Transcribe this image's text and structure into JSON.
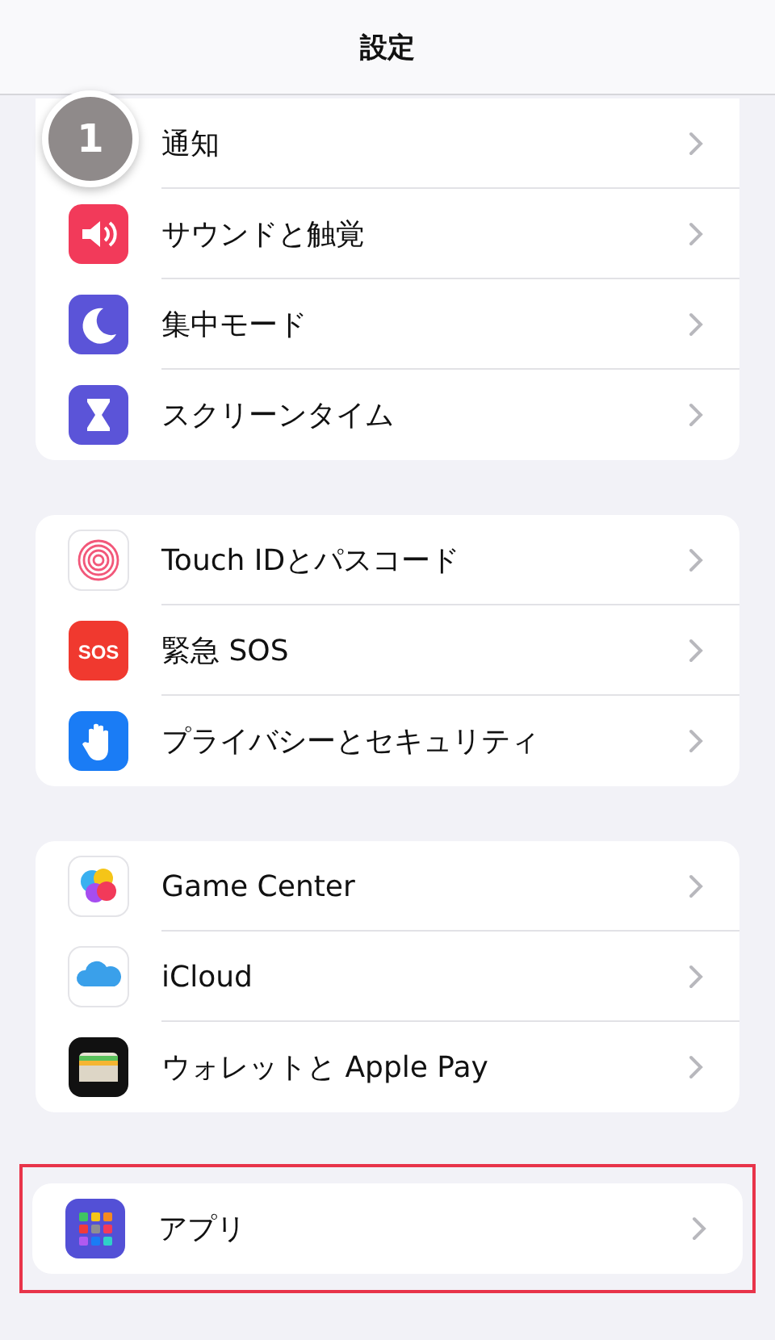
{
  "header": {
    "title": "設定"
  },
  "step_badge": {
    "label": "1"
  },
  "groups": [
    {
      "highlighted": false,
      "rows": [
        {
          "label": "通知"
        },
        {
          "kind": "sound",
          "label": "サウンドと触覚"
        },
        {
          "kind": "focus",
          "label": "集中モード"
        },
        {
          "kind": "screen-time",
          "label": "スクリーンタイム"
        }
      ]
    },
    {
      "highlighted": false,
      "rows": [
        {
          "kind": "touch-id",
          "label": "Touch IDとパスコード"
        },
        {
          "kind": "sos",
          "icon_text": "SOS",
          "label": "緊急 SOS"
        },
        {
          "kind": "privacy",
          "label": "プライバシーとセキュリティ"
        }
      ]
    },
    {
      "highlighted": false,
      "rows": [
        {
          "kind": "game-center",
          "label": "Game Center"
        },
        {
          "kind": "icloud",
          "label": "iCloud"
        },
        {
          "kind": "wallet",
          "label": "ウォレットと Apple Pay"
        }
      ]
    },
    {
      "highlighted": true,
      "rows": [
        {
          "kind": "apps",
          "label": "アプリ"
        }
      ]
    }
  ]
}
